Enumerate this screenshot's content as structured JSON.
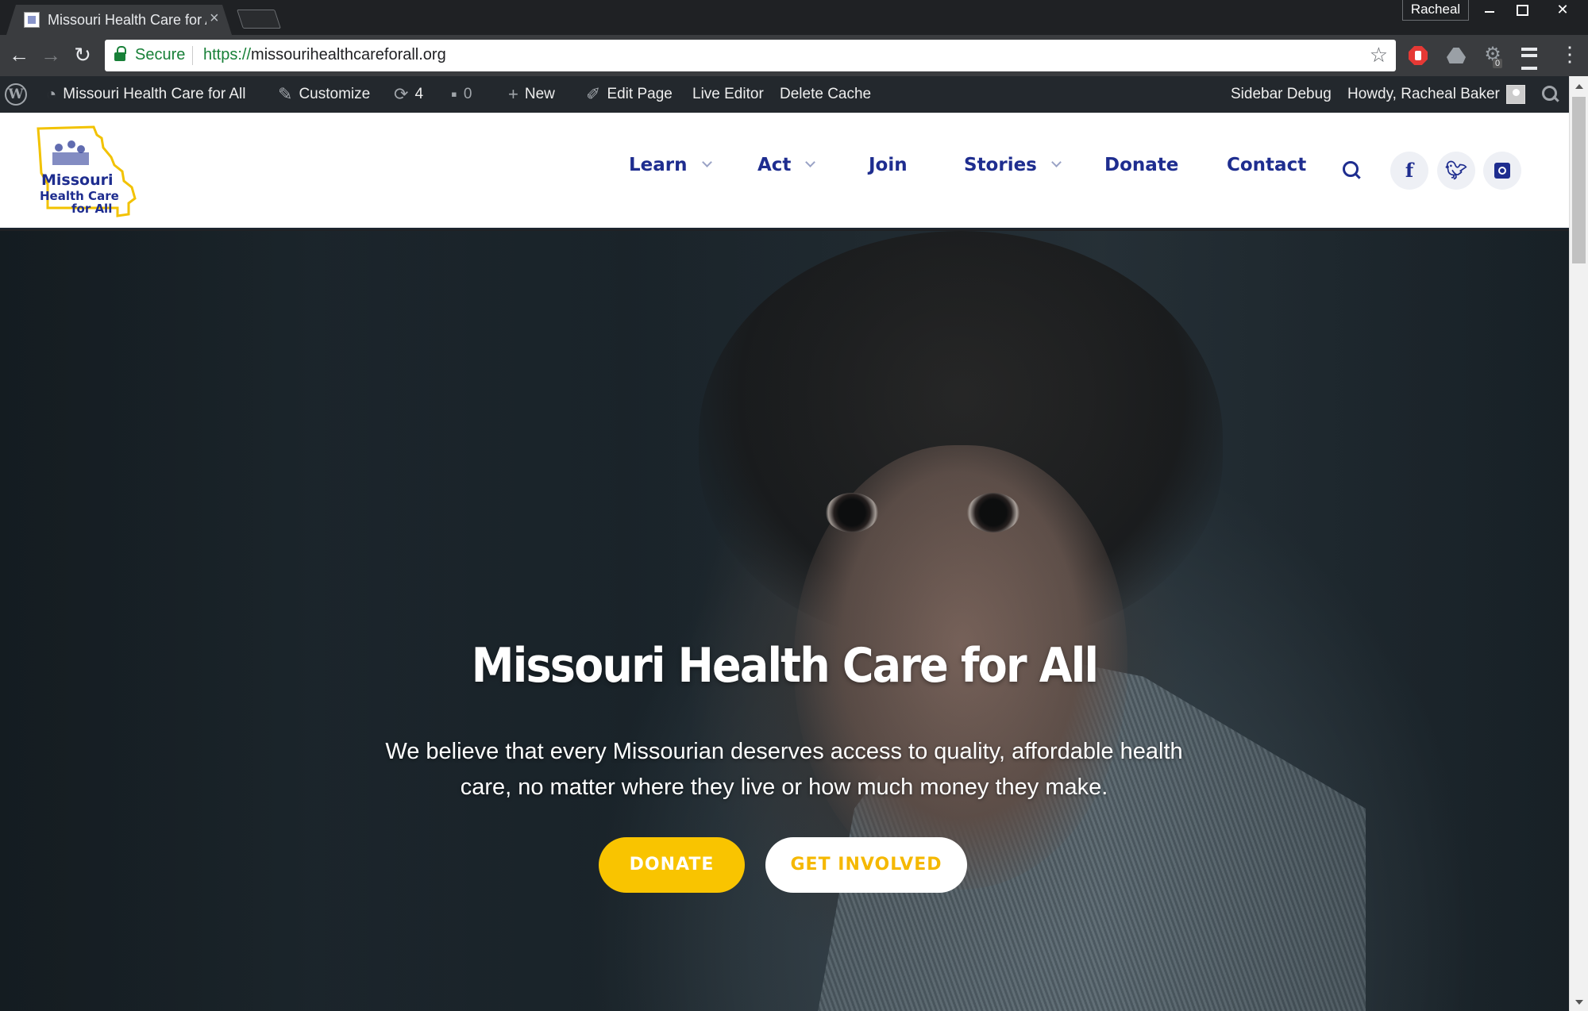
{
  "browser": {
    "tab_title": "Missouri Health Care for All",
    "profile_name": "Racheal",
    "secure_label": "Secure",
    "url_scheme": "https://",
    "url_host": "missourihealthcareforall.org",
    "extension_badge": "0"
  },
  "admin_bar": {
    "site_name": "Missouri Health Care for All",
    "customize": "Customize",
    "updates_count": "4",
    "comments_count": "0",
    "new": "New",
    "edit_page": "Edit Page",
    "live_editor": "Live Editor",
    "delete_cache": "Delete Cache",
    "sidebar_debug": "Sidebar Debug",
    "howdy": "Howdy, Racheal Baker"
  },
  "site": {
    "logo_lines": [
      "Missouri",
      "Health Care",
      "for All"
    ],
    "nav": [
      "Learn",
      "Act",
      "Join",
      "Stories",
      "Donate",
      "Contact"
    ],
    "social": [
      "facebook-icon",
      "twitter-icon",
      "instagram-icon"
    ]
  },
  "hero": {
    "title": "Missouri Health Care for All",
    "subtitle": "We believe that every Missourian deserves access to quality, affordable health care, no matter where they live or how much money they make.",
    "primary_button": "DONATE",
    "secondary_button": "GET INVOLVED"
  },
  "colors": {
    "brand_navy": "#1e2d8f",
    "brand_yellow": "#f9c400",
    "admin_bar": "#23282d",
    "secure_green": "#188038"
  }
}
